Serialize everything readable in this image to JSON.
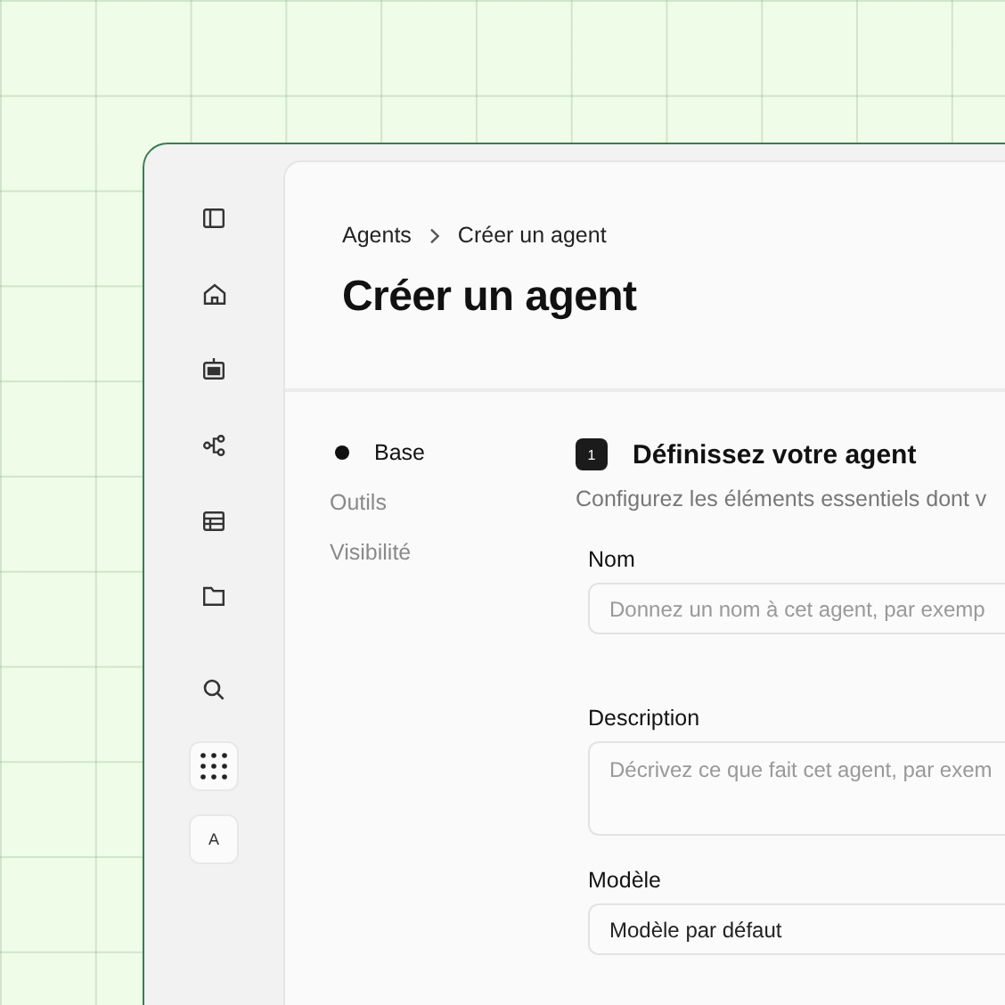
{
  "sidebar": {
    "items": [
      {
        "kind": "nav"
      },
      {
        "kind": "nav"
      },
      {
        "kind": "nav"
      },
      {
        "kind": "nav"
      },
      {
        "kind": "nav"
      },
      {
        "kind": "nav"
      },
      {
        "kind": "nav"
      },
      {
        "kind": "tile"
      },
      {
        "kind": "avatar",
        "label": "A"
      }
    ]
  },
  "breadcrumb": [
    "Agents",
    "Créer un agent"
  ],
  "title": "Créer un agent",
  "steps": [
    {
      "label": "Base",
      "selected": true
    },
    {
      "label": "Outils",
      "selected": false
    },
    {
      "label": "Visibilité",
      "selected": false
    }
  ],
  "section": {
    "number": "1",
    "heading": "Définissez votre agent",
    "subtitle": "Configurez les éléments essentiels dont v"
  },
  "fields": [
    {
      "kind": "input",
      "label": "Nom",
      "placeholder": "Donnez un nom à cet agent, par exemp"
    },
    {
      "kind": "textarea",
      "label": "Description",
      "placeholder": "Décrivez ce que fait cet agent, par exem"
    },
    {
      "kind": "select",
      "label": "Modèle",
      "value": "Modèle par défaut"
    }
  ]
}
